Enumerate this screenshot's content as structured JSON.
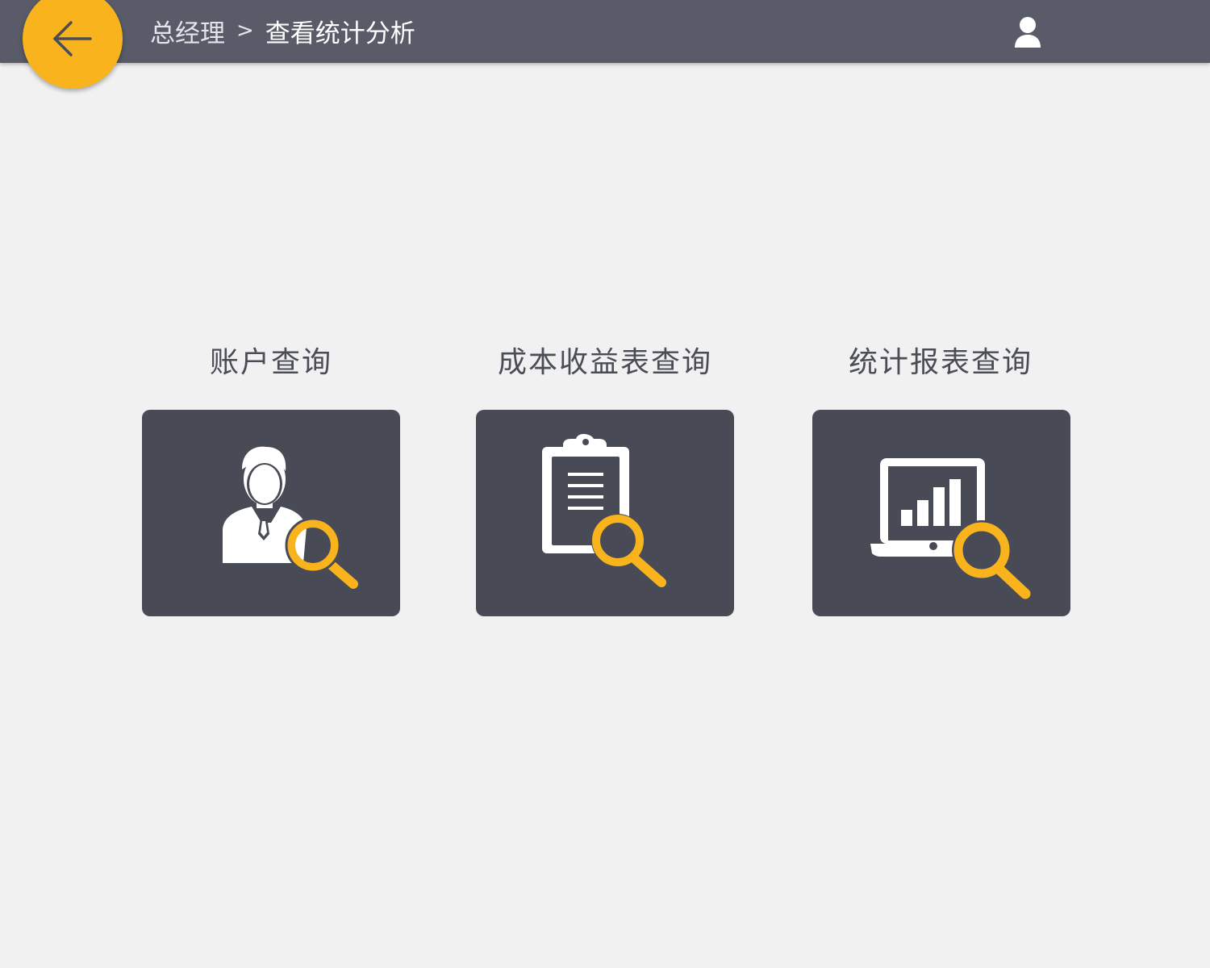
{
  "header": {
    "back_icon": "arrow-left-icon",
    "breadcrumb": {
      "parent": "总经理",
      "separator": ">",
      "current": "查看统计分析"
    },
    "user_icon": "user-icon"
  },
  "colors": {
    "header_bg": "#595c68",
    "accent": "#f9b31c",
    "card_bg": "#484b56",
    "page_bg": "#f1f1f1",
    "label_text": "#4b4d56"
  },
  "cards": [
    {
      "label": "账户查询",
      "icon": "account-search-icon"
    },
    {
      "label": "成本收益表查询",
      "icon": "clipboard-search-icon"
    },
    {
      "label": "统计报表查询",
      "icon": "report-chart-search-icon"
    }
  ]
}
